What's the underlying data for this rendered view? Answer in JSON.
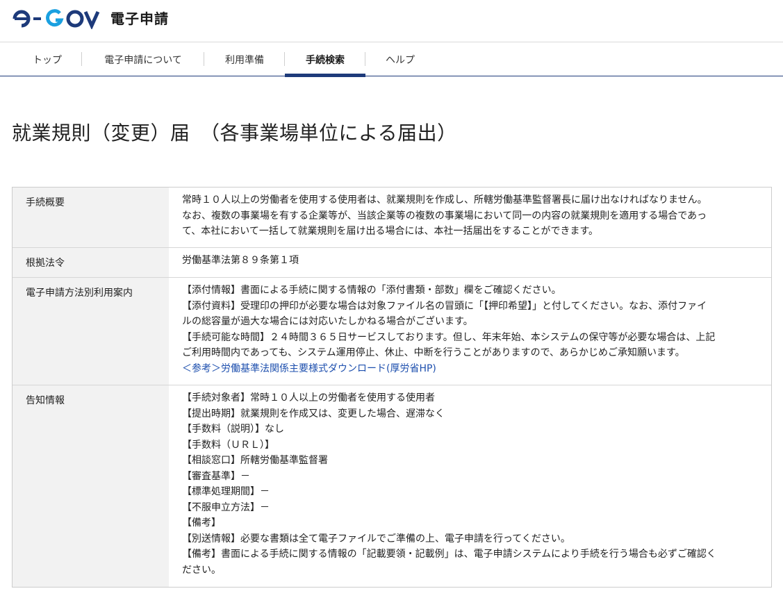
{
  "header": {
    "logo_text": "e-GOV",
    "service_name": "電子申請"
  },
  "nav": {
    "items": [
      {
        "label": "トップ"
      },
      {
        "label": "電子申請について"
      },
      {
        "label": "利用準備"
      },
      {
        "label": "手続検索",
        "active": true
      },
      {
        "label": "ヘルプ"
      }
    ]
  },
  "page": {
    "title": "就業規則（変更）届　（各事業場単位による届出）"
  },
  "info": {
    "overview": {
      "label": "手続概要",
      "lines": [
        "常時１０人以上の労働者を使用する使用者は、就業規則を作成し、所轄労働基準監督署長に届け出なければなりません。",
        "なお、複数の事業場を有する企業等が、当該企業等の複数の事業場において同一の内容の就業規則を適用する場合であっ",
        "て、本社において一括して就業規則を届け出る場合には、本社一括届出をすることができます。"
      ]
    },
    "legal_basis": {
      "label": "根拠法令",
      "value": "労働基準法第８９条第１項"
    },
    "guide": {
      "label": "電子申請方法別利用案内",
      "line1": "【添付情報】書面による手続に関する情報の「添付書類・部数」欄をご確認ください。",
      "line2_highlight": "【添付資料】受理印の押印が必要な場合は対象ファイル名の冒頭に「【押印希望】」と付してください。",
      "line2_rest": "なお、添付ファイ",
      "line3": "ルの総容量が過大な場合には対応いたしかねる場合がございます。",
      "line4": "【手続可能な時間】２４時間３６５日サービスしております。但し、年末年始、本システムの保守等が必要な場合は、上記",
      "line5": "ご利用時間内であっても、システム運用停止、休止、中断を行うことがありますので、あらかじめご承知願います。",
      "link": "＜参考＞労働基準法関係主要様式ダウンロード(厚労省HP)"
    },
    "notice": {
      "label": "告知情報",
      "lines": [
        "【手続対象者】常時１０人以上の労働者を使用する使用者",
        "【提出時期】就業規則を作成又は、変更した場合、遅滞なく",
        "【手数料（説明）】なし",
        "【手数料（ＵＲＬ）】",
        "【相談窓口】所轄労働基準監督署",
        "【審査基準】－",
        "【標準処理期間】－",
        "【不服申立方法】－",
        "【備考】",
        "【別送情報】必要な書類は全て電子ファイルでご準備の上、電子申請を行ってください。",
        "【備考】書面による手続に関する情報の「記載要領・記載例」は、電子申請システムにより手続を行う場合も必ずご確認く",
        "ださい。"
      ]
    }
  },
  "colors": {
    "brand_navy": "#1d3a7a",
    "brand_cyan": "#1aa0e0",
    "link": "#1d4fae",
    "highlight_underline": "#c8102e",
    "label_bg": "#f2f2f2"
  }
}
